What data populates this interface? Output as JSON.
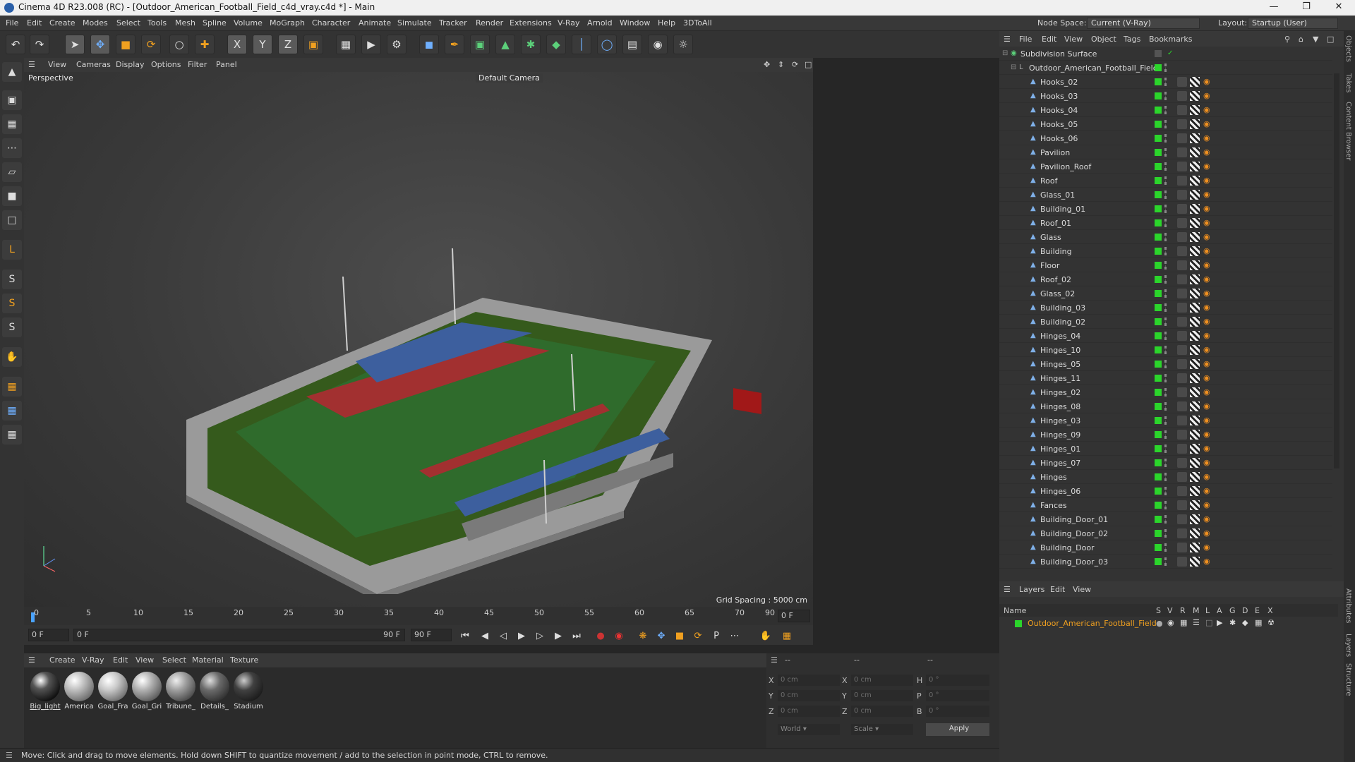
{
  "window": {
    "title": "Cinema 4D R23.008 (RC) - [Outdoor_American_Football_Field_c4d_vray.c4d *] - Main"
  },
  "menu": [
    "File",
    "Edit",
    "Create",
    "Modes",
    "Select",
    "Tools",
    "Mesh",
    "Spline",
    "Volume",
    "MoGraph",
    "Character",
    "Animate",
    "Simulate",
    "Tracker",
    "Render",
    "Extensions",
    "V-Ray",
    "Arnold",
    "Window",
    "Help",
    "3DToAll"
  ],
  "node_space": {
    "label": "Node Space:",
    "value": "Current (V-Ray)"
  },
  "layout": {
    "label": "Layout:",
    "value": "Startup (User)"
  },
  "viewport": {
    "menu": [
      "View",
      "Cameras",
      "Display",
      "Options",
      "Filter",
      "Panel"
    ],
    "label": "Perspective",
    "camera": "Default Camera",
    "grid_spacing": "Grid Spacing : 5000 cm"
  },
  "timeline": {
    "ticks": [
      "0",
      "5",
      "10",
      "15",
      "20",
      "25",
      "30",
      "35",
      "40",
      "45",
      "50",
      "55",
      "60",
      "65",
      "70",
      "75",
      "80",
      "85",
      "90"
    ],
    "frame_end_box": "0 F",
    "start": "0 F",
    "current": "0 F",
    "end": "90 F",
    "end2": "90 F"
  },
  "materials": {
    "menu": [
      "Create",
      "V-Ray",
      "Edit",
      "View",
      "Select",
      "Material",
      "Texture"
    ],
    "items": [
      {
        "name": "Big_light",
        "color": "#2e2e2e"
      },
      {
        "name": "America",
        "color": "#bdbdbd"
      },
      {
        "name": "Goal_Fra",
        "color": "#c8c8c8"
      },
      {
        "name": "Goal_Gri",
        "color": "#b0b0b0"
      },
      {
        "name": "Tribune_",
        "color": "#9e9e9e"
      },
      {
        "name": "Details_",
        "color": "#6a6a6a"
      },
      {
        "name": "Stadium",
        "color": "#404040"
      }
    ]
  },
  "coords": {
    "headers": [
      "--",
      "--",
      "--"
    ],
    "rows": [
      {
        "a": "X",
        "av": "0 cm",
        "b": "X",
        "bv": "0 cm",
        "c": "H",
        "cv": "0 °"
      },
      {
        "a": "Y",
        "av": "0 cm",
        "b": "Y",
        "bv": "0 cm",
        "c": "P",
        "cv": "0 °"
      },
      {
        "a": "Z",
        "av": "0 cm",
        "b": "Z",
        "bv": "0 cm",
        "c": "B",
        "cv": "0 °"
      }
    ],
    "mode1": "World",
    "mode2": "Scale",
    "apply": "Apply"
  },
  "status": "Move: Click and drag to move elements. Hold down SHIFT to quantize movement / add to the selection in point mode, CTRL to remove.",
  "objects": {
    "menu": [
      "File",
      "Edit",
      "View",
      "Object",
      "Tags",
      "Bookmarks"
    ],
    "root": "Subdivision Surface",
    "parent": "Outdoor_American_Football_Field",
    "items": [
      "Hooks_02",
      "Hooks_03",
      "Hooks_04",
      "Hooks_05",
      "Hooks_06",
      "Pavilion",
      "Pavilion_Roof",
      "Roof",
      "Glass_01",
      "Building_01",
      "Roof_01",
      "Glass",
      "Building",
      "Floor",
      "Roof_02",
      "Glass_02",
      "Building_03",
      "Building_02",
      "Hinges_04",
      "Hinges_10",
      "Hinges_05",
      "Hinges_11",
      "Hinges_02",
      "Hinges_08",
      "Hinges_03",
      "Hinges_09",
      "Hinges_01",
      "Hinges_07",
      "Hinges",
      "Hinges_06",
      "Fances",
      "Building_Door_01",
      "Building_Door_02",
      "Building_Door",
      "Building_Door_03"
    ]
  },
  "layers": {
    "menu": [
      "Layers",
      "Edit",
      "View"
    ],
    "headers": {
      "name": "Name",
      "cols": [
        "S",
        "V",
        "R",
        "M",
        "L",
        "A",
        "G",
        "D",
        "E",
        "X"
      ]
    },
    "item": "Outdoor_American_Football_Field"
  },
  "right_tabs": [
    "Objects",
    "Takes",
    "Content Browser",
    "Attributes",
    "Layers",
    "Structure"
  ]
}
